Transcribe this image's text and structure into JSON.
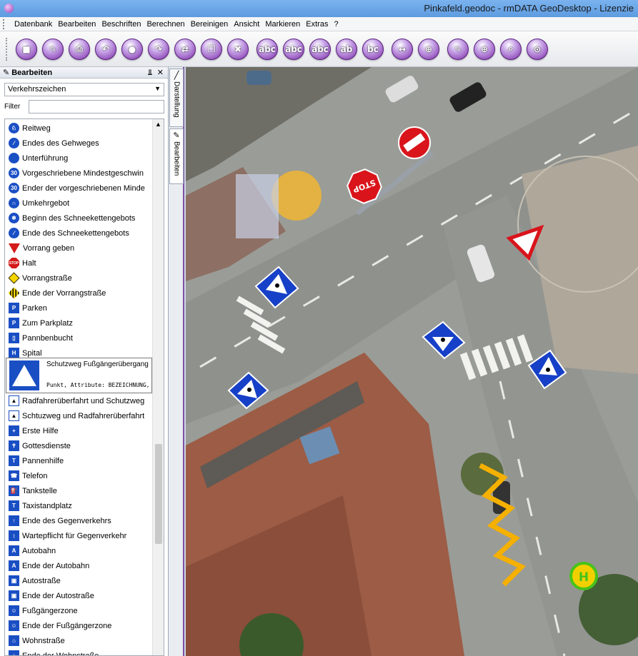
{
  "window": {
    "title": "Pinkafeld.geodoc - rmDATA GeoDesktop - Lizenzie"
  },
  "menu": [
    "Datenbank",
    "Bearbeiten",
    "Beschriften",
    "Berechnen",
    "Bereinigen",
    "Ansicht",
    "Markieren",
    "Extras",
    "?"
  ],
  "toolbar": {
    "buttons": [
      {
        "name": "save-icon",
        "glyph": "■"
      },
      {
        "name": "cancel-edit-icon",
        "glyph": "✎"
      },
      {
        "name": "print-icon",
        "glyph": "⎙"
      },
      {
        "name": "import-icon",
        "glyph": "↶"
      },
      {
        "name": "circle-icon",
        "glyph": "●"
      },
      {
        "name": "undo-icon",
        "glyph": "↷"
      },
      {
        "name": "link-icon",
        "glyph": "⇄"
      },
      {
        "name": "copy-icon",
        "glyph": "❐"
      },
      {
        "name": "delete-icon",
        "glyph": "✖"
      },
      {
        "name": "label-add-icon",
        "glyph": "abc"
      },
      {
        "name": "label-multi-icon",
        "glyph": "abc"
      },
      {
        "name": "label-edit-icon",
        "glyph": "abc"
      },
      {
        "name": "label-delete-icon",
        "glyph": "ab"
      },
      {
        "name": "label-move-icon",
        "glyph": "bc"
      },
      {
        "name": "move-icon",
        "glyph": "↔"
      },
      {
        "name": "target-icon",
        "glyph": "⊕"
      },
      {
        "name": "zoom-pen-icon",
        "glyph": "✎"
      },
      {
        "name": "zoom-in-icon",
        "glyph": "⊕"
      },
      {
        "name": "zoom-icon",
        "glyph": "⌕"
      },
      {
        "name": "zoom-extent-icon",
        "glyph": "⊙"
      }
    ]
  },
  "panel": {
    "title": "Bearbeiten",
    "pin": "⫫",
    "close": "✕",
    "category": "Verkehrszeichen",
    "filter_label": "Filter",
    "filter_value": "",
    "items": [
      {
        "label": "Reitweg",
        "icon": "blue-circle",
        "glyph": "♘"
      },
      {
        "label": "Endes des Gehweges",
        "icon": "blue-circle",
        "glyph": "∕"
      },
      {
        "label": "Unterführung",
        "icon": "diamond-blue",
        "glyph": ""
      },
      {
        "label": "Vorgeschriebene Mindestgeschwin",
        "icon": "blue-circle",
        "glyph": "30"
      },
      {
        "label": "Ender der vorgeschriebenen Minde",
        "icon": "blue-circle",
        "glyph": "30"
      },
      {
        "label": "Umkehrgebot",
        "icon": "blue-circle",
        "glyph": "∩"
      },
      {
        "label": "Beginn des Schneekettengebots",
        "icon": "blue-circle",
        "glyph": "❄"
      },
      {
        "label": "Ende des Schneekettengebots",
        "icon": "blue-circle",
        "glyph": "∕"
      },
      {
        "label": "Vorrang geben",
        "icon": "tri-down",
        "glyph": ""
      },
      {
        "label": "Halt",
        "icon": "red-oct",
        "glyph": "STOP"
      },
      {
        "label": "Vorrangstraße",
        "icon": "diamond",
        "glyph": ""
      },
      {
        "label": "Ende der Vorrangstraße",
        "icon": "diamond-x",
        "glyph": ""
      },
      {
        "label": "Parken",
        "icon": "blue-sq",
        "glyph": "P"
      },
      {
        "label": "Zum Parkplatz",
        "icon": "blue-sq",
        "glyph": "P"
      },
      {
        "label": "Pannbenbucht",
        "icon": "blue-sq",
        "glyph": "▯"
      },
      {
        "label": "Spital",
        "icon": "blue-sq",
        "glyph": "H"
      }
    ],
    "selected": {
      "label": "Schutzweg Fußgängerübergang",
      "description": "Punkt, Attribute: BEZEICHNUNG,"
    },
    "items_after": [
      {
        "label": "Radfahrerüberfahrt und Schutzweg",
        "icon": "tri-up",
        "glyph": "▲"
      },
      {
        "label": "Schtuzweg und Radfahrerüberfahrt",
        "icon": "tri-up",
        "glyph": "▲"
      },
      {
        "label": "Erste Hilfe",
        "icon": "blue-sq",
        "glyph": "+"
      },
      {
        "label": "Gottesdienste",
        "icon": "blue-sq",
        "glyph": "✝"
      },
      {
        "label": "Pannenhilfe",
        "icon": "blue-sq",
        "glyph": "T"
      },
      {
        "label": "Telefon",
        "icon": "blue-sq",
        "glyph": "☎"
      },
      {
        "label": "Tankstelle",
        "icon": "blue-sq",
        "glyph": "⛽"
      },
      {
        "label": "Taxistandplatz",
        "icon": "blue-sq",
        "glyph": "T"
      },
      {
        "label": "Ende des Gegenverkehrs",
        "icon": "blue-sq",
        "glyph": "↑"
      },
      {
        "label": "Wartepflicht für Gegenverkehr",
        "icon": "blue-sq",
        "glyph": "↕"
      },
      {
        "label": "Autobahn",
        "icon": "blue-sq",
        "glyph": "A"
      },
      {
        "label": "Ende der Autobahn",
        "icon": "blue-sq",
        "glyph": "A"
      },
      {
        "label": "Autostraße",
        "icon": "blue-sq",
        "glyph": "▣"
      },
      {
        "label": "Ende der Autostraße",
        "icon": "blue-sq",
        "glyph": "▣"
      },
      {
        "label": "Fußgängerzone",
        "icon": "blue-sq",
        "glyph": "☺"
      },
      {
        "label": "Ende der Fußgängerzone",
        "icon": "blue-sq",
        "glyph": "☺"
      },
      {
        "label": "Wohnstraße",
        "icon": "blue-sq",
        "glyph": "⌂"
      },
      {
        "label": "Ende der Wohnstraße",
        "icon": "blue-sq",
        "glyph": "⌂"
      }
    ]
  },
  "side_tabs": [
    {
      "label": "Darstellung",
      "icon": "╱"
    },
    {
      "label": "Bearbeiten",
      "icon": "✎"
    }
  ],
  "map": {
    "stop_text": "STOP",
    "bus_stop_text": "H"
  }
}
